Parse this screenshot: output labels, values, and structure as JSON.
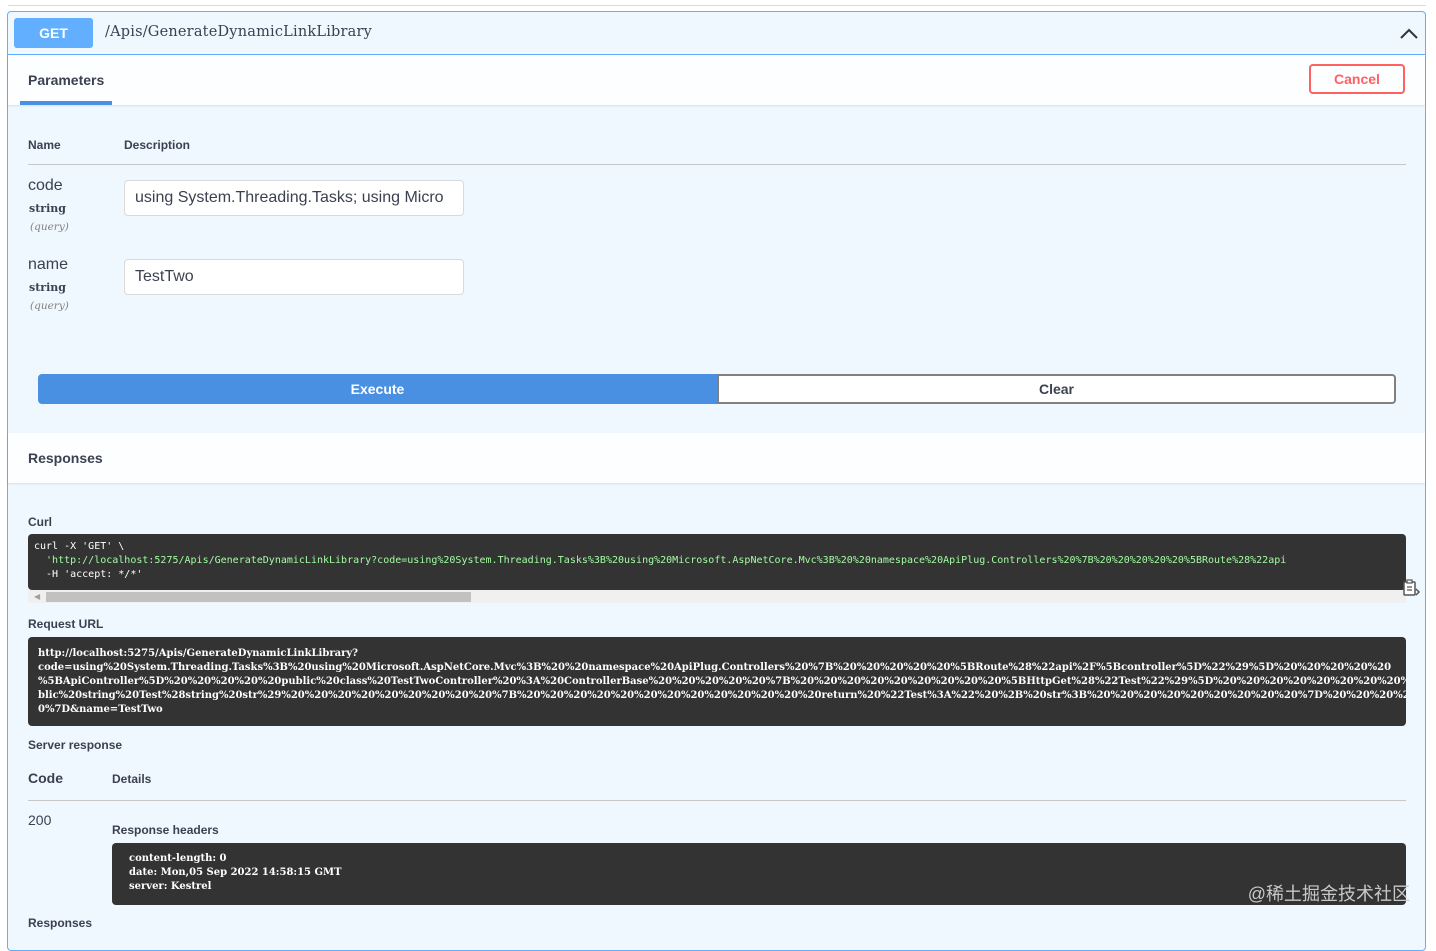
{
  "endpoint": {
    "method": "GET",
    "path": "/Apis/GenerateDynamicLinkLibrary",
    "collapse_icon": "chevron-up-icon"
  },
  "parameters": {
    "tab_label": "Parameters",
    "cancel_label": "Cancel",
    "col_name": "Name",
    "col_description": "Description",
    "items": [
      {
        "name": "code",
        "type": "string",
        "in": "(query)",
        "value": "using System.Threading.Tasks; using Micro"
      },
      {
        "name": "name",
        "type": "string",
        "in": "(query)",
        "value": "TestTwo"
      }
    ],
    "execute_label": "Execute",
    "clear_label": "Clear"
  },
  "responses": {
    "title": "Responses",
    "curl_label": "Curl",
    "curl_line1": "curl -X 'GET' \\",
    "curl_line2": "  'http://localhost:5275/Apis/GenerateDynamicLinkLibrary?code=using%20System.Threading.Tasks%3B%20using%20Microsoft.AspNetCore.Mvc%3B%20%20namespace%20ApiPlug.Controllers%20%7B%20%20%20%20%20%5BRoute%28%22api",
    "curl_line3": "  -H 'accept: */*'",
    "copy_icon": "copy-to-clipboard-icon",
    "request_url_label": "Request URL",
    "request_url": "http://localhost:5275/Apis/GenerateDynamicLinkLibrary?\ncode=using%20System.Threading.Tasks%3B%20using%20Microsoft.AspNetCore.Mvc%3B%20%20namespace%20ApiPlug.Controllers%20%7B%20%20%20%20%20%5BRoute%28%22api%2F%5Bcontroller%5D%22%29%5D%20%20%20%20%20\n%5BApiController%5D%20%20%20%20%20public%20class%20TestTwoController%20%3A%20ControllerBase%20%20%20%20%20%7B%20%20%20%20%20%20%20%20%20%5BHttpGet%28%22Test%22%29%5D%20%20%20%20%20%20%20%20%20pu\nblic%20string%20Test%28string%20str%29%20%20%20%20%20%20%20%20%20%7B%20%20%20%20%20%20%20%20%20%20%20%20%20return%20%22Test%3A%22%20%2B%20str%3B%20%20%20%20%20%20%20%20%20%7D%20%20%20%20%20%7D%2\n0%7D&name=TestTwo",
    "server_response_label": "Server response",
    "code_header": "Code",
    "details_header": "Details",
    "status_code": "200",
    "response_headers_label": "Response headers",
    "response_headers": "content-length: 0\ndate: Mon,05 Sep 2022 14:58:15 GMT\nserver: Kestrel",
    "bottom_label": "Responses"
  },
  "watermark": "@稀土掘金技术社区"
}
